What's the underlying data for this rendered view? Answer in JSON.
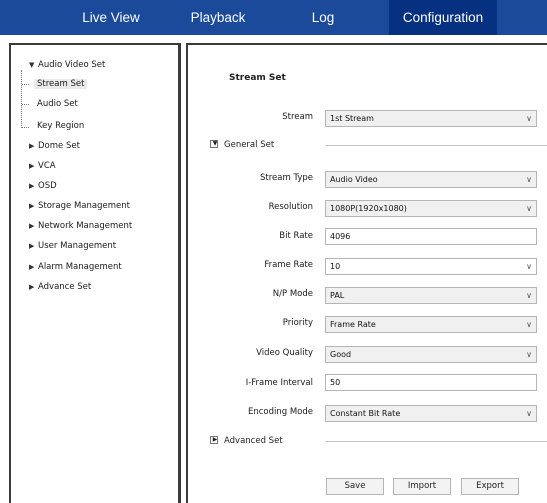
{
  "nav": {
    "items": [
      "Live View",
      "Playback",
      "Log",
      "Configuration"
    ],
    "active": "Configuration"
  },
  "tree": {
    "audio_video_set": {
      "label": "Audio Video Set",
      "children": [
        "Stream Set",
        "Audio Set",
        "Key Region"
      ],
      "selected": "Stream Set"
    },
    "items": [
      "Dome Set",
      "VCA",
      "OSD",
      "Storage Management",
      "Network Management",
      "User Management",
      "Alarm Management",
      "Advance Set"
    ]
  },
  "form": {
    "title": "Stream Set",
    "stream": {
      "label": "Stream",
      "value": "1st Stream"
    },
    "general_set": "General Set",
    "stream_type": {
      "label": "Stream Type",
      "value": "Audio Video"
    },
    "resolution": {
      "label": "Resolution",
      "value": "1080P(1920x1080)"
    },
    "bit_rate": {
      "label": "Bit Rate",
      "value": "4096"
    },
    "frame_rate": {
      "label": "Frame Rate",
      "value": "10"
    },
    "np_mode": {
      "label": "N/P Mode",
      "value": "PAL"
    },
    "priority": {
      "label": "Priority",
      "value": "Frame Rate"
    },
    "video_quality": {
      "label": "Video Quality",
      "value": "Good"
    },
    "iframe_interval": {
      "label": "I-Frame Interval",
      "value": "50"
    },
    "encoding_mode": {
      "label": "Encoding Mode",
      "value": "Constant Bit Rate"
    },
    "advanced_set": "Advanced Set"
  },
  "buttons": {
    "save": "Save",
    "import": "Import",
    "export": "Export"
  },
  "icons": {
    "expanded": "triangle-down-icon",
    "collapsed": "triangle-right-icon",
    "dropdown": "chevron-down-icon"
  },
  "colors": {
    "nav_bg": "#1b4a9a",
    "nav_active": "#063080",
    "panel_border": "#3b3b3b",
    "select_grey": "#f0f0f0"
  }
}
